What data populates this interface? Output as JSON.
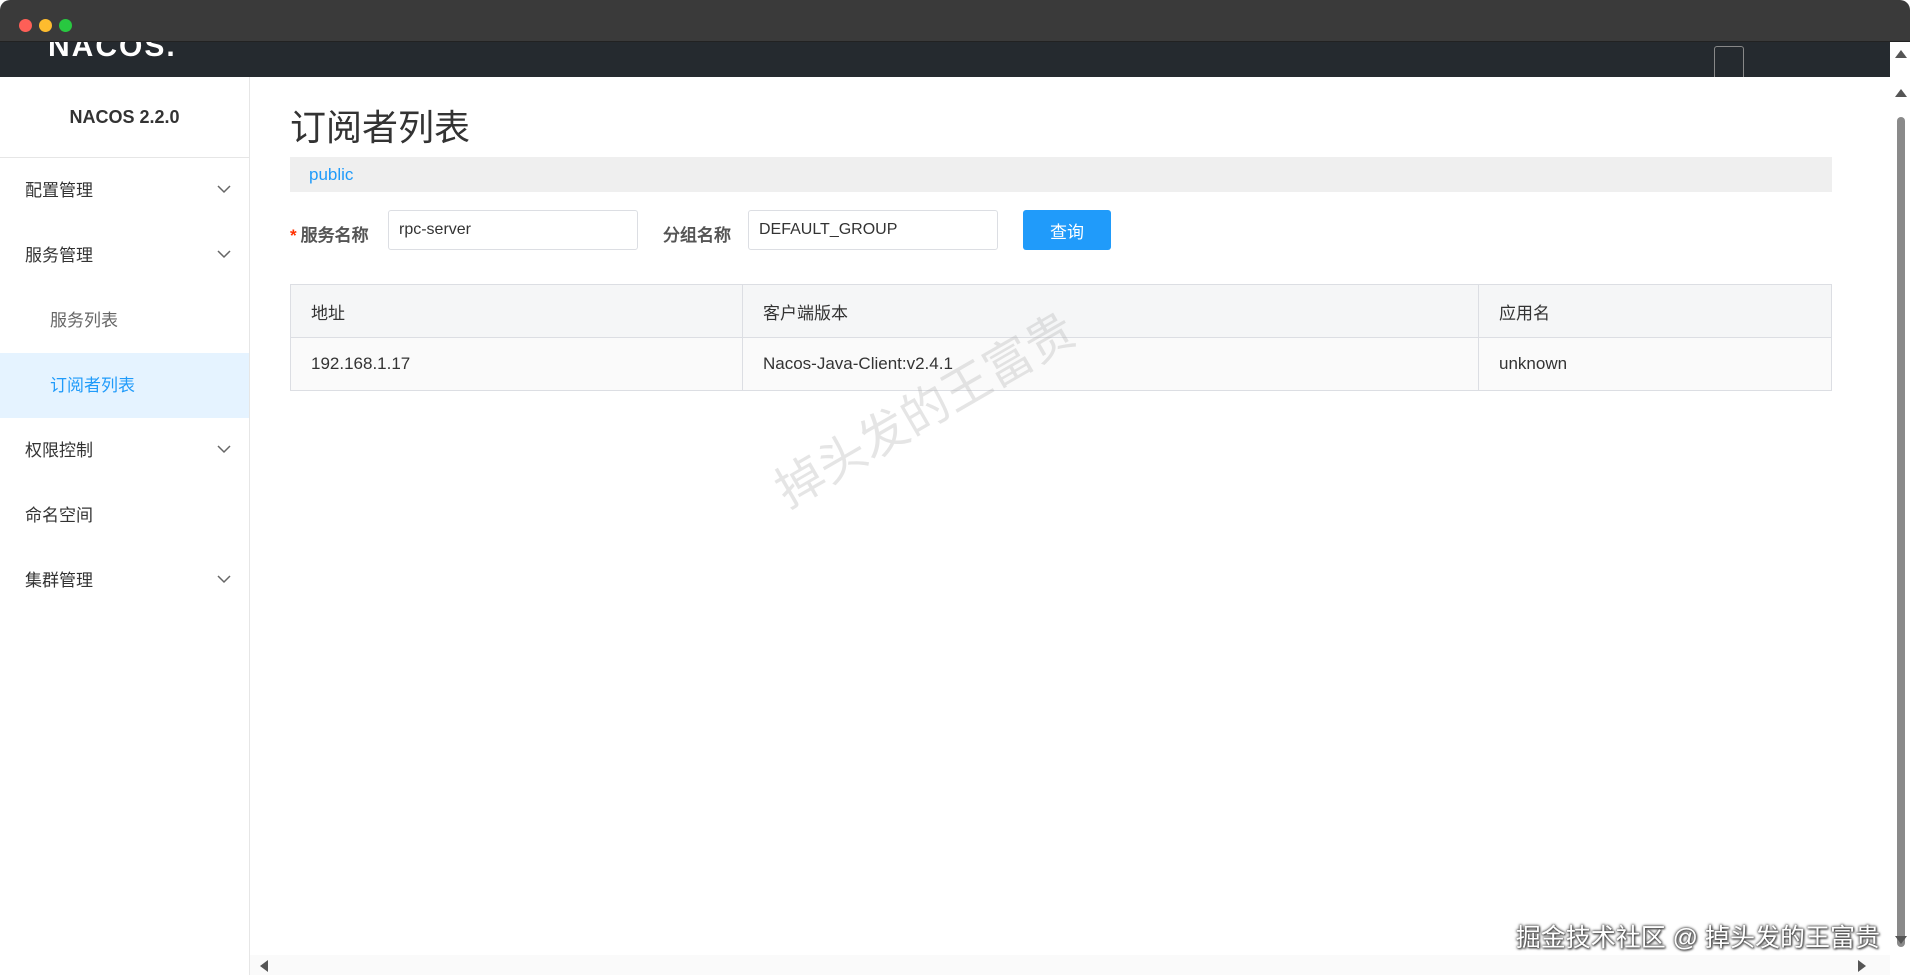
{
  "window": {
    "header_logo": "NACOS."
  },
  "sidebar": {
    "brand": "NACOS 2.2.0",
    "items": [
      {
        "label": "配置管理",
        "expandable": true
      },
      {
        "label": "服务管理",
        "expandable": true
      },
      {
        "label": "服务列表",
        "sub": true
      },
      {
        "label": "订阅者列表",
        "sub": true,
        "active": true
      },
      {
        "label": "权限控制",
        "expandable": true
      },
      {
        "label": "命名空间",
        "expandable": false
      },
      {
        "label": "集群管理",
        "expandable": true
      }
    ]
  },
  "main": {
    "title": "订阅者列表",
    "namespace": "public",
    "form": {
      "required_mark": "*",
      "service_label": "服务名称",
      "service_value": "rpc-server",
      "group_label": "分组名称",
      "group_value": "DEFAULT_GROUP",
      "query_label": "查询"
    },
    "table": {
      "headers": [
        "地址",
        "客户端版本",
        "应用名"
      ],
      "rows": [
        [
          "192.168.1.17",
          "Nacos-Java-Client:v2.4.1",
          "unknown"
        ]
      ]
    }
  },
  "watermark": "掉头发的王富贵",
  "corner_watermark": "掘金技术社区 @ 掉头发的王富贵",
  "colors": {
    "accent": "#209bfa",
    "active_bg": "#e5f3ff",
    "header_bg": "#252a2f",
    "required": "#ff3000"
  }
}
